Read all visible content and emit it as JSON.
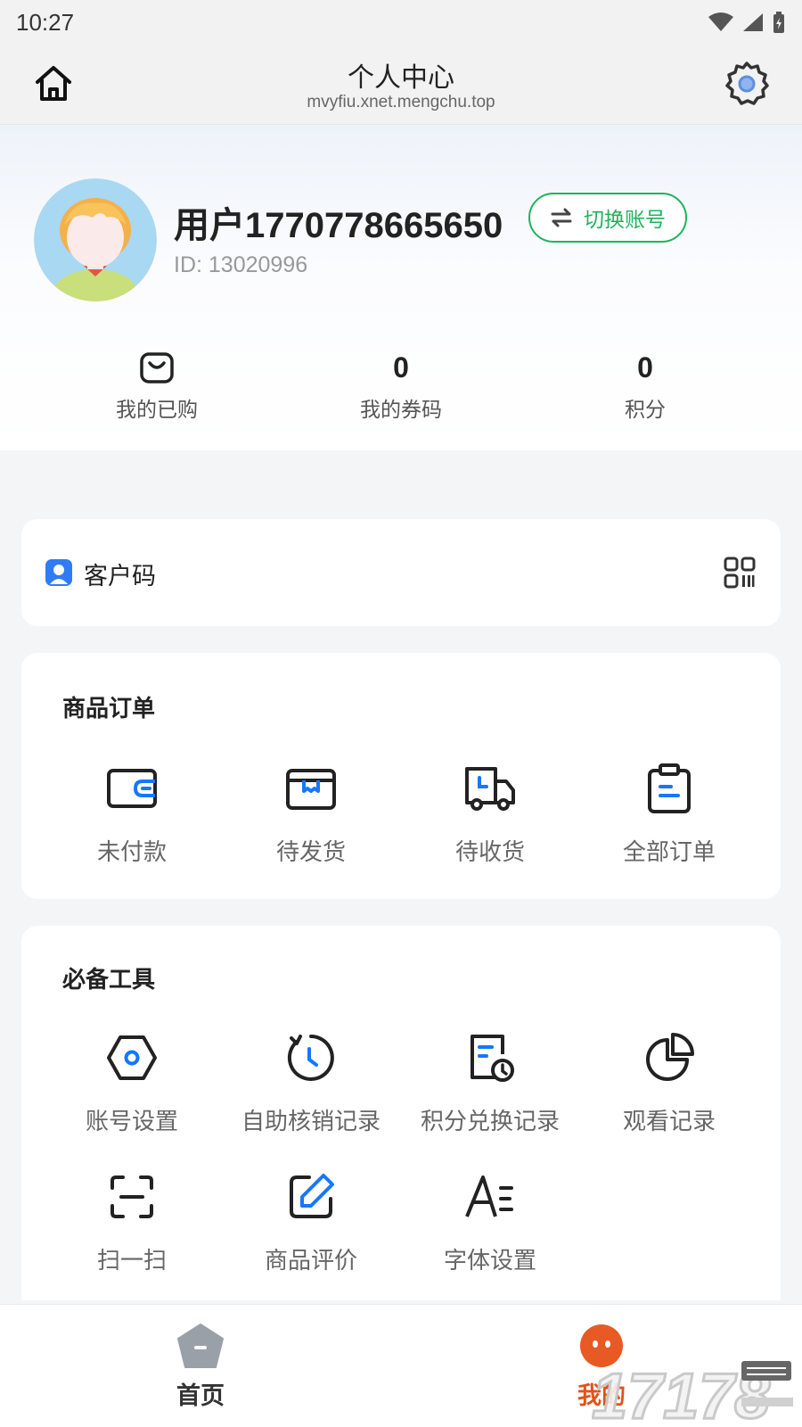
{
  "status_bar": {
    "time": "10:27"
  },
  "header": {
    "title": "个人中心",
    "url": "mvyfiu.xnet.mengchu.top"
  },
  "profile": {
    "username": "用户1770778665650",
    "user_id": "ID: 13020996",
    "switch_label": "切换账号"
  },
  "stats": {
    "purchased_label": "我的已购",
    "coupons_value": "0",
    "coupons_label": "我的券码",
    "points_value": "0",
    "points_label": "积分"
  },
  "customer_code": {
    "label": "客户码"
  },
  "orders": {
    "title": "商品订单",
    "items": [
      {
        "label": "未付款",
        "icon": "wallet-icon"
      },
      {
        "label": "待发货",
        "icon": "box-icon"
      },
      {
        "label": "待收货",
        "icon": "truck-icon"
      },
      {
        "label": "全部订单",
        "icon": "clipboard-icon"
      }
    ]
  },
  "tools": {
    "title": "必备工具",
    "items": [
      {
        "label": "账号设置",
        "icon": "hexagon-settings-icon"
      },
      {
        "label": "自助核销记录",
        "icon": "history-clock-icon"
      },
      {
        "label": "积分兑换记录",
        "icon": "document-clock-icon"
      },
      {
        "label": "观看记录",
        "icon": "pie-chart-icon"
      },
      {
        "label": "扫一扫",
        "icon": "scan-icon"
      },
      {
        "label": "商品评价",
        "icon": "edit-icon"
      },
      {
        "label": "字体设置",
        "icon": "font-icon"
      }
    ]
  },
  "tabbar": {
    "tabs": [
      {
        "label": "首页",
        "active": false
      },
      {
        "label": "我的",
        "active": true
      }
    ]
  },
  "colors": {
    "accent_green": "#1fb35b",
    "accent_blue": "#1677ff",
    "active_tab": "#e0531c"
  }
}
